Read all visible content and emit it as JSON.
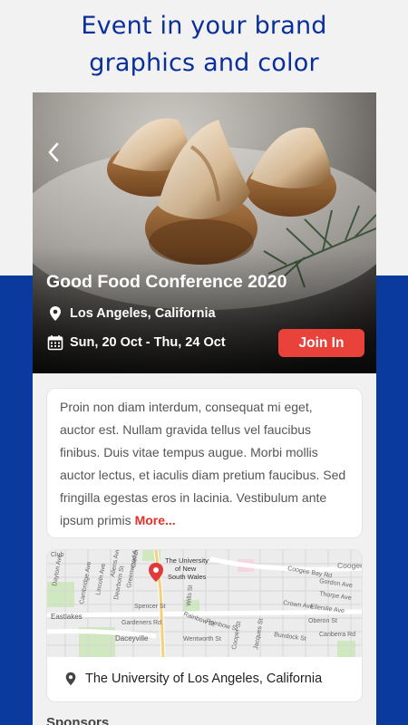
{
  "promo": {
    "headline_line1": "Event in your brand",
    "headline_line2": "graphics and color"
  },
  "event": {
    "title": "Good Food Conference 2020",
    "location": "Los Angeles, California",
    "dates": "Sun, 20 Oct - Thu, 24 Oct",
    "join_label": "Join In",
    "description": "Proin non diam interdum, consequat mi eget, auctor est. Nullam gravida tellus vel faucibus finibus. Duis vitae tempus augue. Morbi mollis auctor lectus, et iaculis diam pretium faucibus. Sed fringilla egestas eros in lacinia. Vestibulum ante ipsum primis",
    "more_label": "More..."
  },
  "map": {
    "pin_label_line1": "The University",
    "pin_label_line2": "of New",
    "pin_label_line3": "South Wales",
    "labels": [
      "Club",
      "Dayton Ave",
      "Cambridge Ave",
      "Lincoln Ave",
      "Dearborn St",
      "Aliens Ave",
      "Spencer St",
      "Greenwood Ave",
      "Cambridge Ave",
      "Wills St",
      "Coogee Bay Rd",
      "Coogee",
      "Gordon Ave",
      "Thorpe Ave",
      "Crown Ave",
      "Ellerslie Ave",
      "Gardeners Rd",
      "Rainbow St",
      "Rainbow St",
      "Oberon St",
      "Daceyville",
      "Canberra Rd",
      "Bundock St",
      "Eastlakes",
      "Wentworth St",
      "Cooper St",
      "Jacques St"
    ],
    "address": "The University of Los Angeles, California"
  },
  "sections": {
    "sponsors_title": "Sponsors"
  },
  "colors": {
    "brand_blue": "#0a3a9e",
    "headline_blue": "#0b2f9a",
    "accent_red": "#e8423b"
  },
  "icons": {
    "back": "chevron-left-icon",
    "location": "location-pin-icon",
    "calendar": "calendar-icon",
    "map_pin": "map-marker-icon"
  }
}
